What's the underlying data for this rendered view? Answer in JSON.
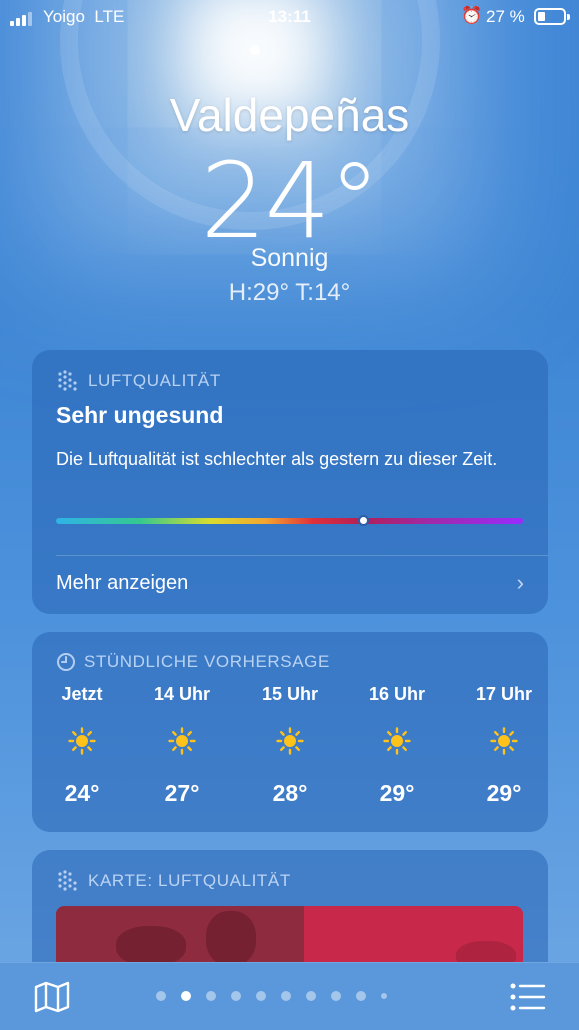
{
  "status_bar": {
    "carrier": "Yoigo",
    "network": "LTE",
    "time": "13:11",
    "battery_percent": "27 %",
    "battery_level": 0.27
  },
  "header": {
    "city": "Valdepeñas",
    "temperature": "24°",
    "condition": "Sonnig",
    "high_low": "H:29°  T:14°"
  },
  "air_quality": {
    "heading": "LUFTQUALITÄT",
    "title": "Sehr ungesund",
    "description": "Die Luftqualität ist schlechter als gestern zu dieser Zeit.",
    "indicator_fraction": 0.66,
    "more_label": "Mehr anzeigen"
  },
  "hourly": {
    "heading": "STÜNDLICHE VORHERSAGE",
    "items": [
      {
        "label": "Jetzt",
        "icon": "sun-icon",
        "temp": "24°"
      },
      {
        "label": "14 Uhr",
        "icon": "sun-icon",
        "temp": "27°"
      },
      {
        "label": "15 Uhr",
        "icon": "sun-icon",
        "temp": "28°"
      },
      {
        "label": "16 Uhr",
        "icon": "sun-icon",
        "temp": "29°"
      },
      {
        "label": "17 Uhr",
        "icon": "sun-icon",
        "temp": "29°"
      }
    ]
  },
  "aq_map": {
    "heading": "KARTE: LUFTQUALITÄT"
  },
  "tab_bar": {
    "page_count": 10,
    "active_page": 1,
    "left_icon": "map-icon",
    "right_icon": "list-icon"
  },
  "colors": {
    "accent_sun": "#ffc21a",
    "card_bg": "rgba(40,100,180,0.55)"
  }
}
